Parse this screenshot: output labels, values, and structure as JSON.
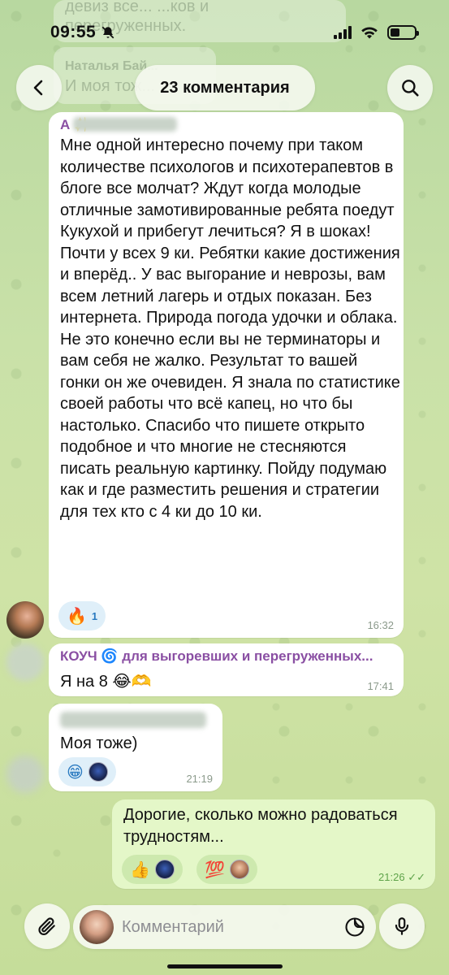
{
  "status_bar": {
    "time": "09:55"
  },
  "header": {
    "title": "23 комментария"
  },
  "faded_top": {
    "line1": "девиз все... ...ков и",
    "line2": "перегруженных.",
    "sender": "Наталья Бай...",
    "line3": "И моя тож..."
  },
  "messages": [
    {
      "sender": "А ✨",
      "text": "Мне одной интересно почему при таком количестве психологов и психотерапевтов в блоге все молчат? Ждут когда молодые отличные замотивированные ребята поедут Кукухой и прибегут лечиться?  Я в шоках! Почти у всех 9 ки. Ребятки какие достижения и вперёд.. У вас выгорание и неврозы, вам всем летний лагерь и отдых показан. Без интернета. Природа погода удочки и облака.  Не это конечно если вы не терминаторы и вам себя не жалко. Результат то вашей гонки он же очевиден. Я знала по статистике своей работы что всё капец, но что бы настолько. Спасибо что пишете открыто подобное и что многие не стесняются писать реальную картинку. Пойду подумаю как и где разместить решения и стратегии для тех кто с 4 ки до 10 ки.",
      "reaction_emoji": "🔥",
      "reaction_count": "1",
      "time": "16:32"
    },
    {
      "sender": "КОУЧ 🌀 для выгоревших и перегруженных...",
      "text": "Я на 8 😂🫶",
      "time": "17:41"
    },
    {
      "text": "Моя тоже)",
      "reaction_emoji": "😁",
      "time": "21:19"
    },
    {
      "text": "Дорогие, сколько можно радоваться трудностям...",
      "reaction1_emoji": "👍",
      "reaction2_emoji": "💯",
      "time": "21:26",
      "check": "✓✓"
    }
  ],
  "composer": {
    "placeholder": "Комментарий"
  },
  "colors": {
    "sender_name": "#8a4fa3",
    "own_bubble": "#e4f7c8",
    "reaction_bg": "#dfeff9",
    "reaction_text": "#2a7ac0",
    "time_text": "#8b9a8b",
    "own_time_text": "#5fa34a"
  },
  "icons": {
    "back": "chevron-left-icon",
    "search": "search-icon",
    "attach": "paperclip-icon",
    "sticker": "sticker-icon",
    "mic": "microphone-icon",
    "mute": "bell-slash-icon"
  }
}
